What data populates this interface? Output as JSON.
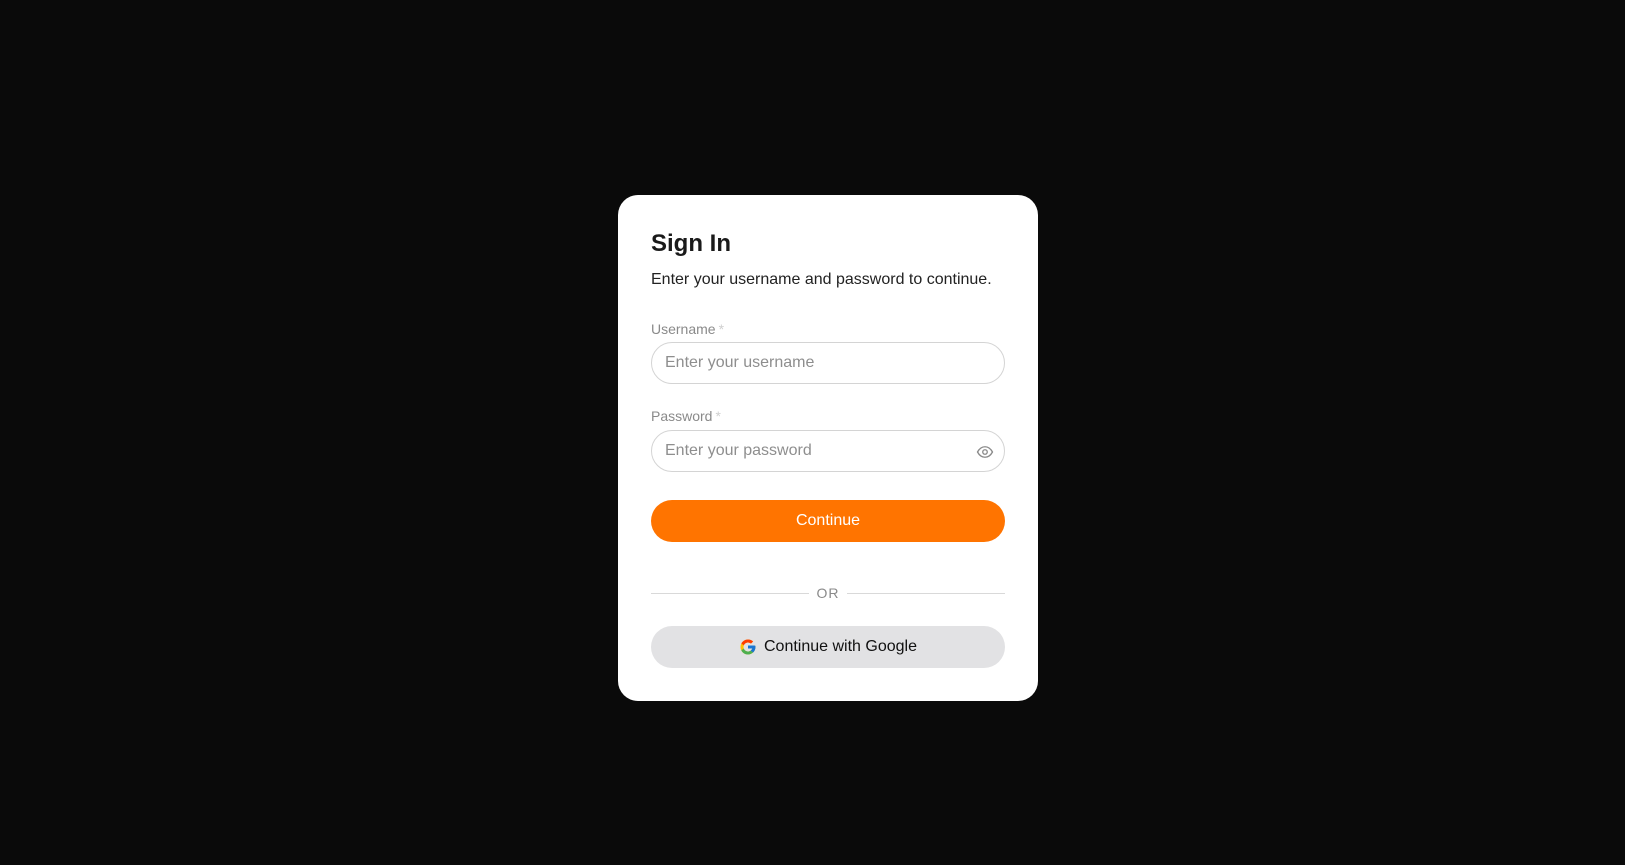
{
  "signin": {
    "title": "Sign In",
    "subtitle": "Enter your username and password to continue.",
    "username": {
      "label": "Username",
      "required_mark": "*",
      "placeholder": "Enter your username",
      "value": ""
    },
    "password": {
      "label": "Password",
      "required_mark": "*",
      "placeholder": "Enter your password",
      "value": "",
      "toggle_icon": "eye-icon"
    },
    "continue_label": "Continue",
    "divider_text": "OR",
    "google_label": "Continue with Google",
    "google_icon": "google-icon"
  },
  "colors": {
    "background": "#0a0a0a",
    "card": "#ffffff",
    "accent": "#ff7400",
    "google_button": "#e2e2e4"
  }
}
